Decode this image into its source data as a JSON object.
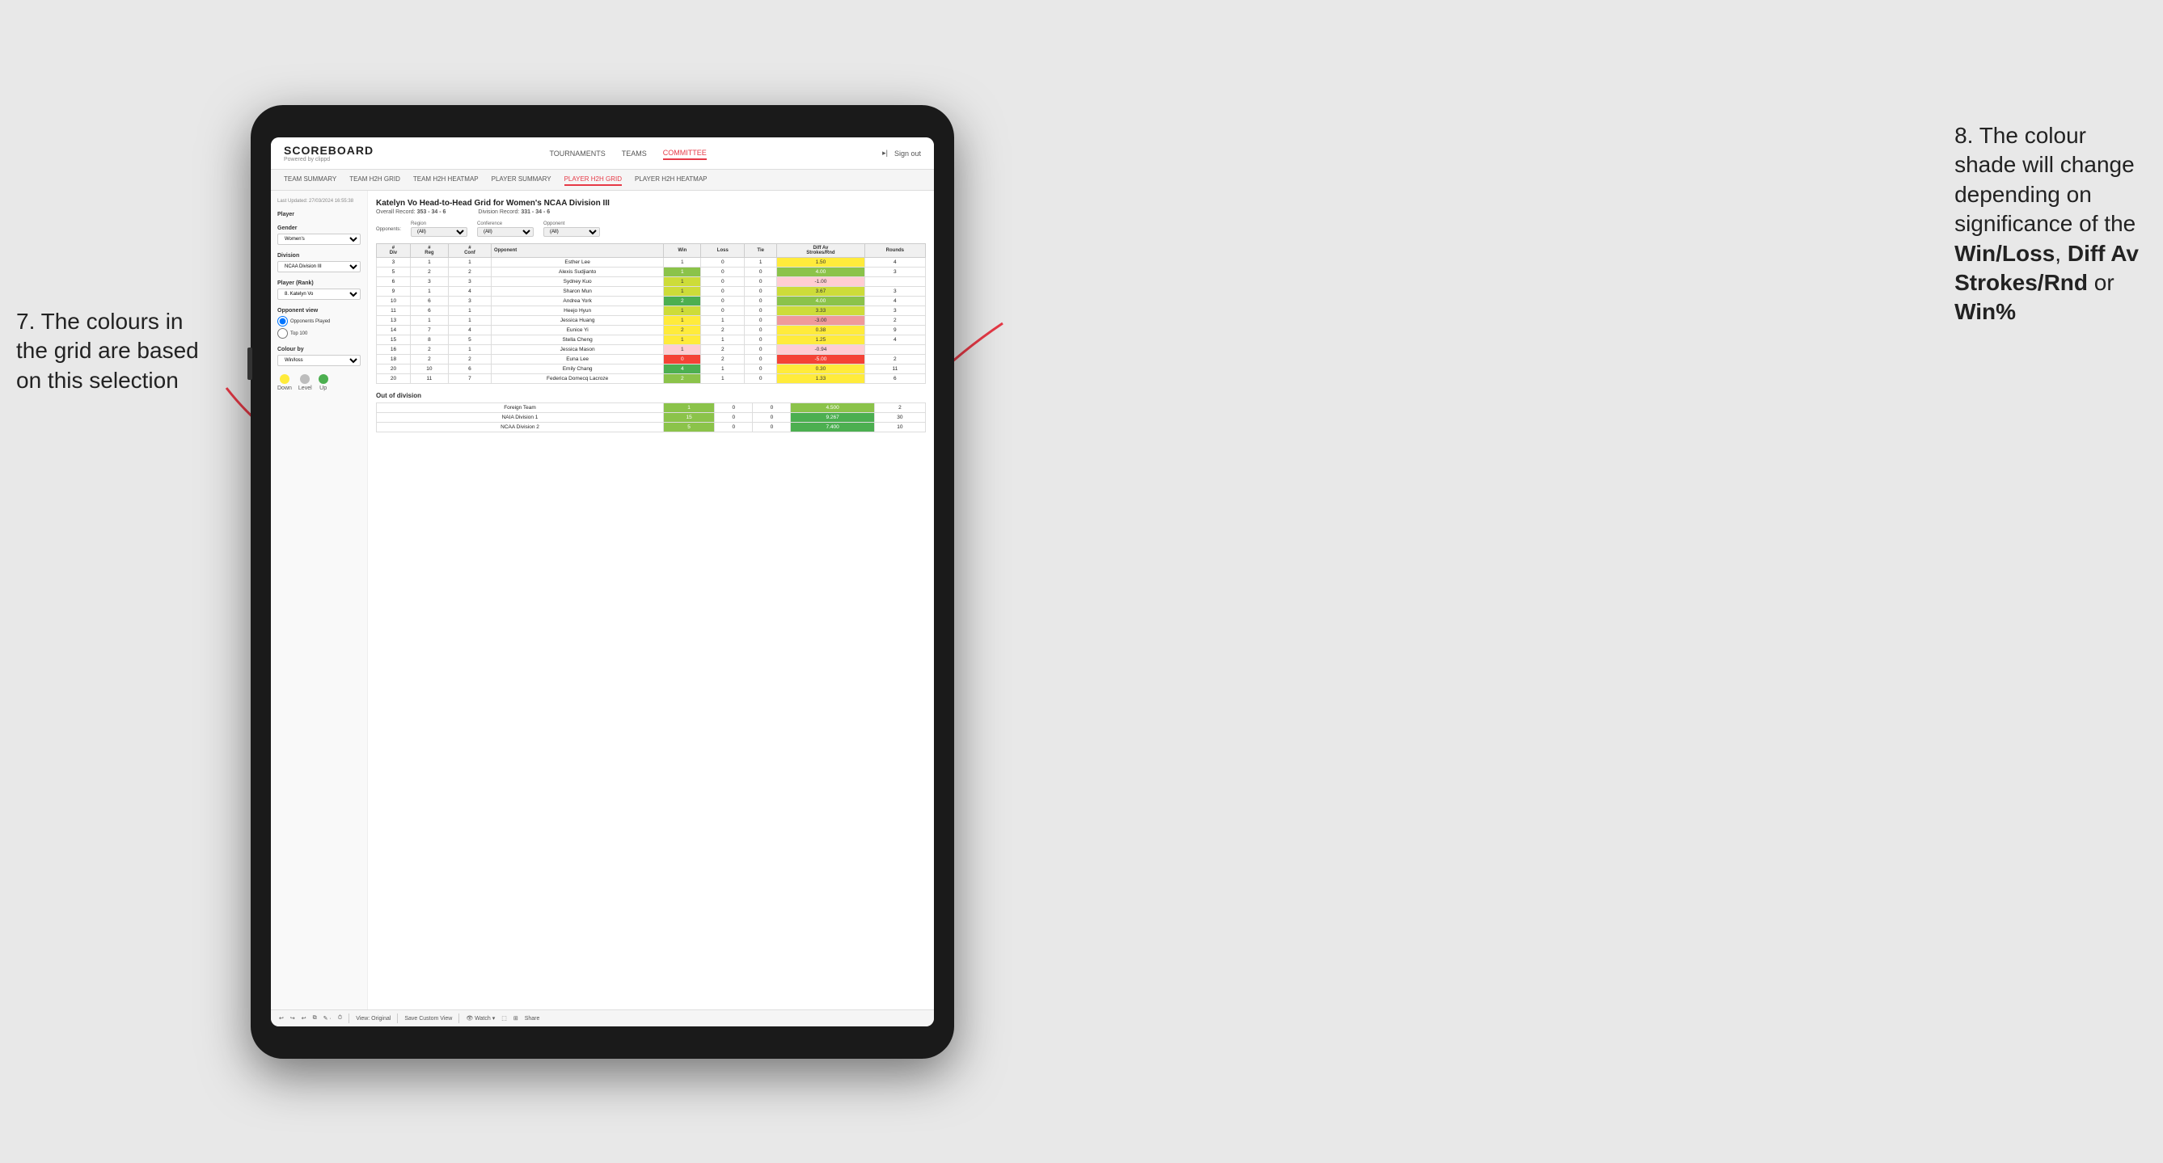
{
  "annotations": {
    "left": {
      "line1": "7. The colours in",
      "line2": "the grid are based",
      "line3": "on this selection"
    },
    "right": {
      "line1": "8. The colour",
      "line2": "shade will change",
      "line3": "depending on",
      "line4": "significance of the",
      "bold1": "Win/Loss",
      "comma1": ", ",
      "bold2": "Diff Av",
      "line5": "Strokes/Rnd",
      "or": " or",
      "bold3": "Win%"
    }
  },
  "header": {
    "logo": "SCOREBOARD",
    "logo_sub": "Powered by clippd",
    "nav": [
      "TOURNAMENTS",
      "TEAMS",
      "COMMITTEE"
    ],
    "active_nav": "COMMITTEE",
    "sign_out": "Sign out"
  },
  "sub_nav": [
    "TEAM SUMMARY",
    "TEAM H2H GRID",
    "TEAM H2H HEATMAP",
    "PLAYER SUMMARY",
    "PLAYER H2H GRID",
    "PLAYER H2H HEATMAP"
  ],
  "active_sub_nav": "PLAYER H2H GRID",
  "sidebar": {
    "timestamp": "Last Updated: 27/03/2024 16:55:38",
    "player_label": "Player",
    "gender_label": "Gender",
    "gender_value": "Women's",
    "division_label": "Division",
    "division_value": "NCAA Division III",
    "player_rank_label": "Player (Rank)",
    "player_rank_value": "8. Katelyn Vo",
    "opponent_view_label": "Opponent view",
    "opponent_played": "Opponents Played",
    "top_100": "Top 100",
    "colour_by_label": "Colour by",
    "colour_by_value": "Win/loss",
    "legend": {
      "down_label": "Down",
      "level_label": "Level",
      "up_label": "Up"
    }
  },
  "grid": {
    "title": "Katelyn Vo Head-to-Head Grid for Women's NCAA Division III",
    "overall_record": "353 - 34 - 6",
    "division_record": "331 - 34 - 6",
    "filter_opponents": "(All)",
    "filter_region": "(All)",
    "filter_conference": "(All)",
    "filter_opponent": "(All)",
    "columns": [
      "#\nDiv",
      "#\nReg",
      "#\nConf",
      "Opponent",
      "Win",
      "Loss",
      "Tie",
      "Diff Av\nStrokes/Rnd",
      "Rounds"
    ],
    "rows": [
      {
        "div": 3,
        "reg": 1,
        "conf": 1,
        "opponent": "Esther Lee",
        "win": 1,
        "loss": 0,
        "tie": 1,
        "diff": 1.5,
        "rounds": 4,
        "win_color": "white",
        "diff_color": "yellow"
      },
      {
        "div": 5,
        "reg": 2,
        "conf": 2,
        "opponent": "Alexis Sudjianto",
        "win": 1,
        "loss": 0,
        "tie": 0,
        "diff": 4.0,
        "rounds": 3,
        "win_color": "green-medium",
        "diff_color": "green-medium"
      },
      {
        "div": 6,
        "reg": 3,
        "conf": 3,
        "opponent": "Sydney Kuo",
        "win": 1,
        "loss": 0,
        "tie": 0,
        "diff": -1.0,
        "rounds": "",
        "win_color": "green-light",
        "diff_color": "red-light"
      },
      {
        "div": 9,
        "reg": 1,
        "conf": 4,
        "opponent": "Sharon Mun",
        "win": 1,
        "loss": 0,
        "tie": 0,
        "diff": 3.67,
        "rounds": 3,
        "win_color": "green-light",
        "diff_color": "green-light"
      },
      {
        "div": 10,
        "reg": 6,
        "conf": 3,
        "opponent": "Andrea York",
        "win": 2,
        "loss": 0,
        "tie": 0,
        "diff": 4.0,
        "rounds": 4,
        "win_color": "green-dark",
        "diff_color": "green-medium"
      },
      {
        "div": 11,
        "reg": 6,
        "conf": 1,
        "opponent": "Heejo Hyun",
        "win": 1,
        "loss": 0,
        "tie": 0,
        "diff": 3.33,
        "rounds": 3,
        "win_color": "green-light",
        "diff_color": "green-light"
      },
      {
        "div": 13,
        "reg": 1,
        "conf": 1,
        "opponent": "Jessica Huang",
        "win": 1,
        "loss": 1,
        "tie": 0,
        "diff": -3.0,
        "rounds": 2,
        "win_color": "yellow",
        "diff_color": "red-medium"
      },
      {
        "div": 14,
        "reg": 7,
        "conf": 4,
        "opponent": "Eunice Yi",
        "win": 2,
        "loss": 2,
        "tie": 0,
        "diff": 0.38,
        "rounds": 9,
        "win_color": "yellow",
        "diff_color": "yellow"
      },
      {
        "div": 15,
        "reg": 8,
        "conf": 5,
        "opponent": "Stella Cheng",
        "win": 1,
        "loss": 1,
        "tie": 0,
        "diff": 1.25,
        "rounds": 4,
        "win_color": "yellow",
        "diff_color": "yellow"
      },
      {
        "div": 16,
        "reg": 2,
        "conf": 1,
        "opponent": "Jessica Mason",
        "win": 1,
        "loss": 2,
        "tie": 0,
        "diff": -0.94,
        "rounds": "",
        "win_color": "red-light",
        "diff_color": "red-light"
      },
      {
        "div": 18,
        "reg": 2,
        "conf": 2,
        "opponent": "Euna Lee",
        "win": 0,
        "loss": 2,
        "tie": 0,
        "diff": -5.0,
        "rounds": 2,
        "win_color": "red-dark",
        "diff_color": "red-dark"
      },
      {
        "div": 20,
        "reg": 10,
        "conf": 6,
        "opponent": "Emily Chang",
        "win": 4,
        "loss": 1,
        "tie": 0,
        "diff": 0.3,
        "rounds": 11,
        "win_color": "green-dark",
        "diff_color": "yellow"
      },
      {
        "div": 20,
        "reg": 11,
        "conf": 7,
        "opponent": "Federica Domecq Lacroze",
        "win": 2,
        "loss": 1,
        "tie": 0,
        "diff": 1.33,
        "rounds": 6,
        "win_color": "green-medium",
        "diff_color": "yellow"
      }
    ],
    "out_of_division_label": "Out of division",
    "out_of_division_rows": [
      {
        "opponent": "Foreign Team",
        "win": 1,
        "loss": 0,
        "tie": 0,
        "diff": 4.5,
        "rounds": 2,
        "diff_color": "green-medium"
      },
      {
        "opponent": "NAIA Division 1",
        "win": 15,
        "loss": 0,
        "tie": 0,
        "diff": 9.267,
        "rounds": 30,
        "diff_color": "green-dark"
      },
      {
        "opponent": "NCAA Division 2",
        "win": 5,
        "loss": 0,
        "tie": 0,
        "diff": 7.4,
        "rounds": 10,
        "diff_color": "green-dark"
      }
    ]
  },
  "toolbar": {
    "view_original": "View: Original",
    "save_custom": "Save Custom View",
    "watch": "Watch",
    "share": "Share"
  }
}
